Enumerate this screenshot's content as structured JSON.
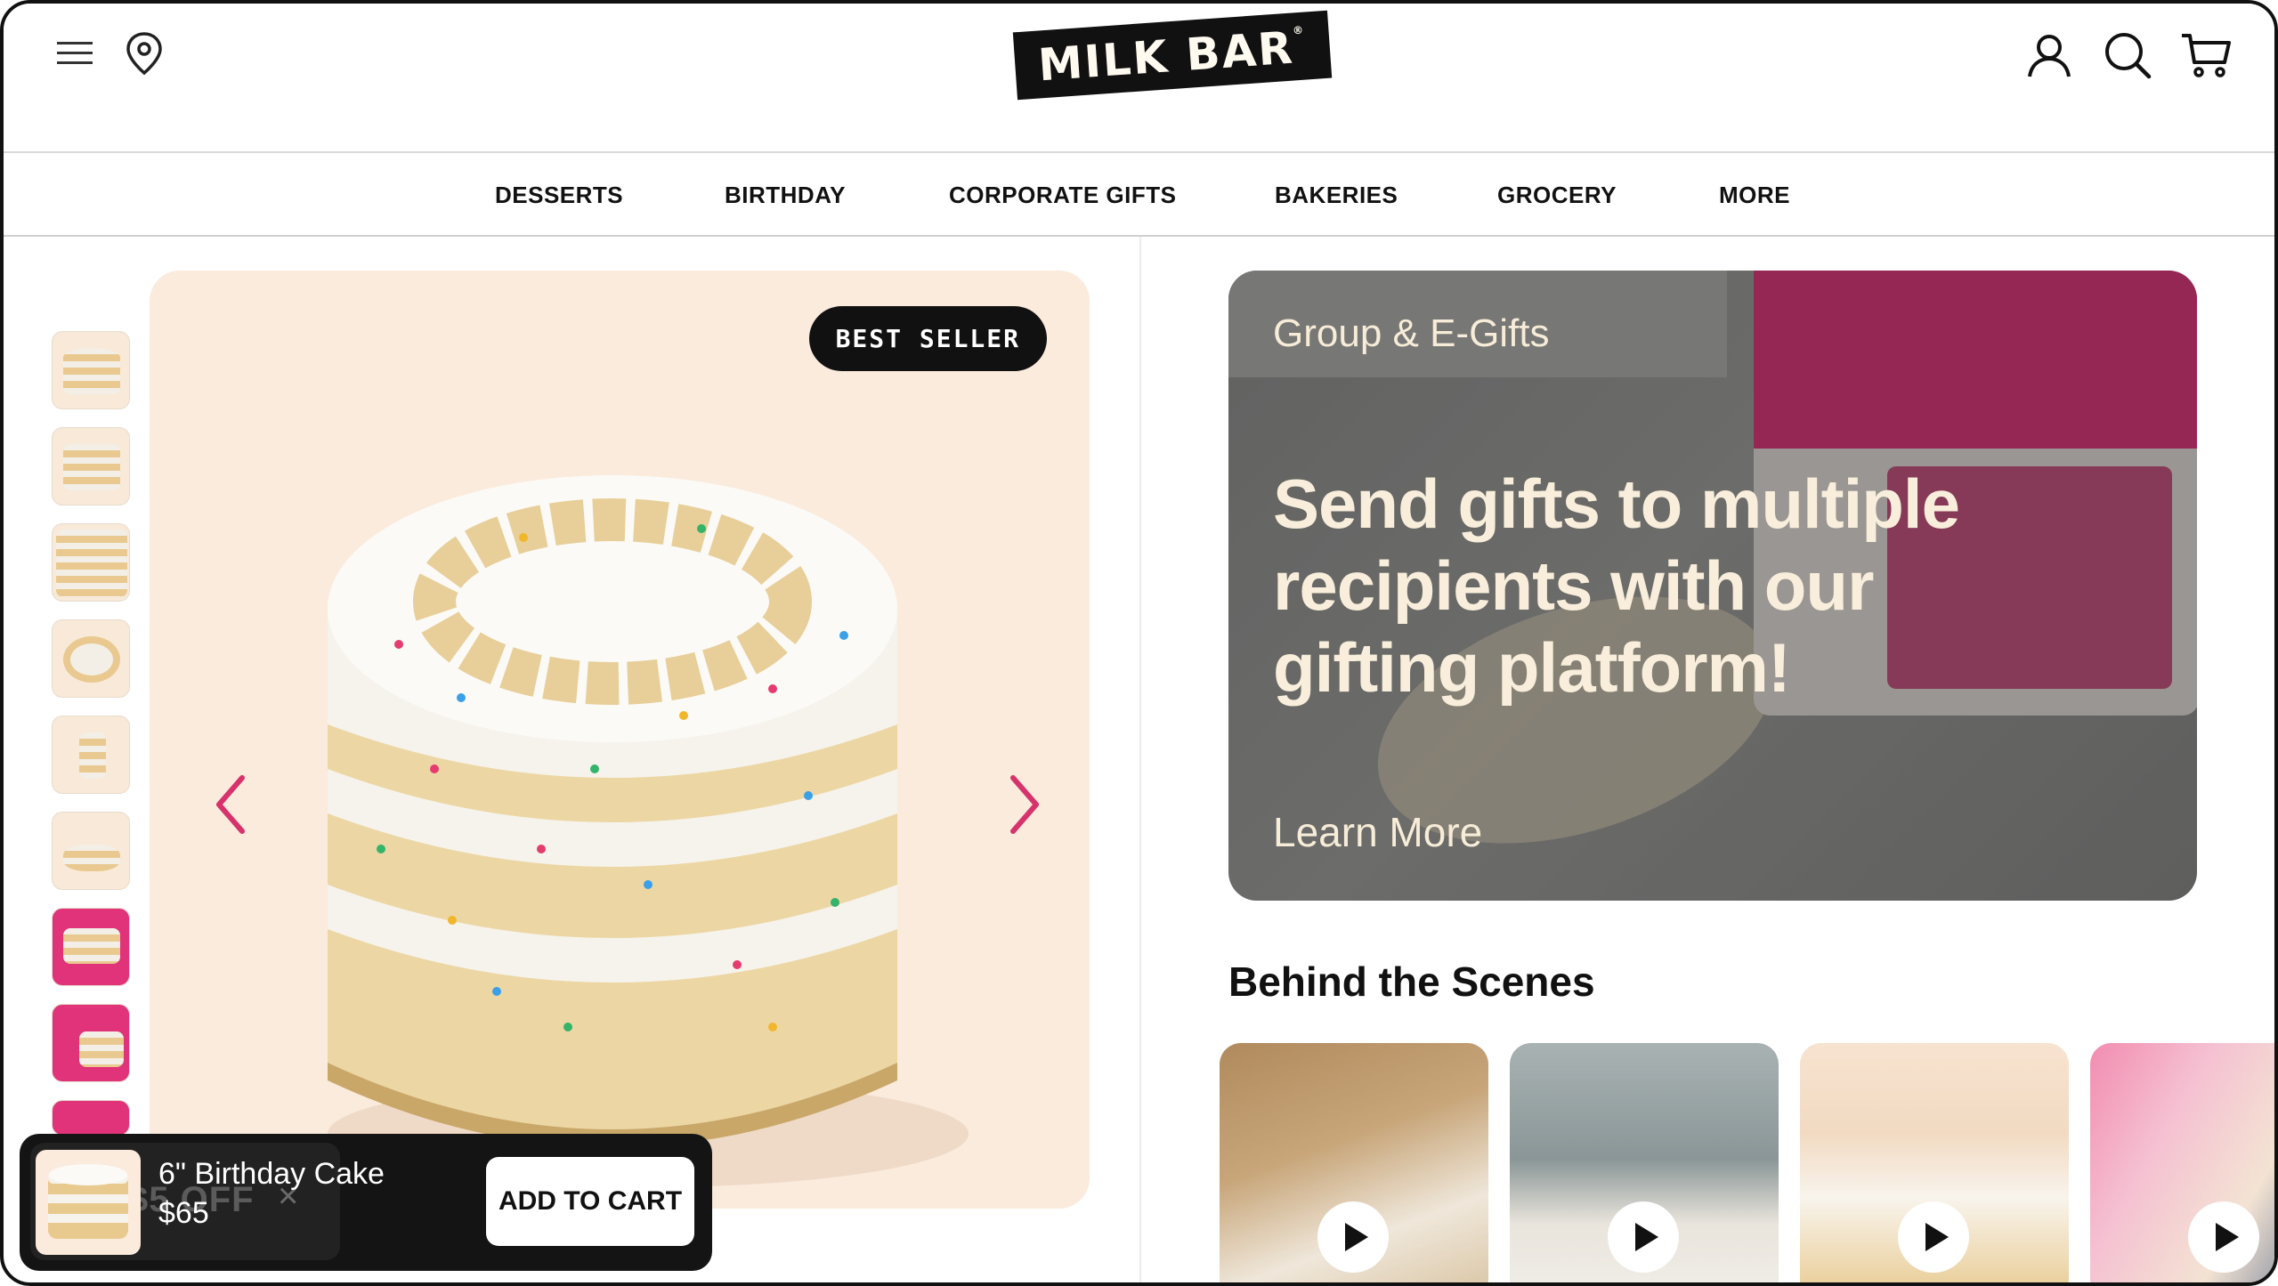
{
  "header": {
    "logo_text": "MILK BAR",
    "menu_icon": "hamburger-menu-icon",
    "location_icon": "map-pin-icon",
    "account_icon": "user-icon",
    "search_icon": "search-icon",
    "cart_icon": "cart-icon"
  },
  "nav": {
    "items": [
      {
        "label": "DESSERTS"
      },
      {
        "label": "BIRTHDAY"
      },
      {
        "label": "CORPORATE GIFTS"
      },
      {
        "label": "BAKERIES"
      },
      {
        "label": "GROCERY"
      },
      {
        "label": "MORE"
      }
    ]
  },
  "product": {
    "badge": "BEST SELLER",
    "prev_icon": "chevron-left-icon",
    "next_icon": "chevron-right-icon"
  },
  "sticky_cart": {
    "name": "6\" Birthday Cake",
    "price": "$65",
    "button": "ADD TO CART",
    "ghost_text": "$5 OFF",
    "ghost_close": "×"
  },
  "promo": {
    "eyebrow": "Group & E-Gifts",
    "headline": "Send gifts to multiple recipients with our gifting platform!",
    "cta": "Learn More"
  },
  "behind_the_scenes": {
    "title": "Behind the Scenes"
  },
  "colors": {
    "accent_pink": "#d6336c",
    "hero_bg": "#fbebdd",
    "dark": "#111111"
  }
}
